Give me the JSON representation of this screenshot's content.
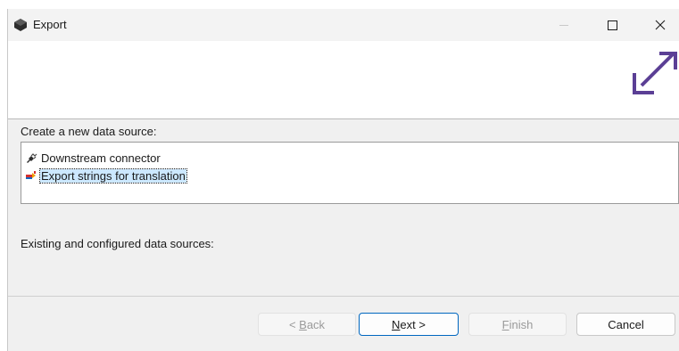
{
  "window": {
    "title": "Export"
  },
  "create_section": {
    "label": "Create a new data source:",
    "items": [
      {
        "label": "Downstream connector",
        "icon": "plug-connector-icon"
      },
      {
        "label": "Export strings for translation",
        "icon": "translation-icon",
        "selected": true
      }
    ]
  },
  "existing_section": {
    "label": "Existing and configured data sources:"
  },
  "buttons": {
    "back": {
      "mnemonic": "B",
      "rest": "ack",
      "prefix": "< ",
      "enabled": false
    },
    "next": {
      "mnemonic": "N",
      "rest": "ext >",
      "enabled": true
    },
    "finish": {
      "mnemonic": "F",
      "rest": "inish",
      "enabled": false
    },
    "cancel": {
      "label": "Cancel",
      "enabled": true
    }
  },
  "colors": {
    "accent": "#0067c0",
    "banner_icon": "#5b3f95",
    "selection": "#cce8ff"
  }
}
